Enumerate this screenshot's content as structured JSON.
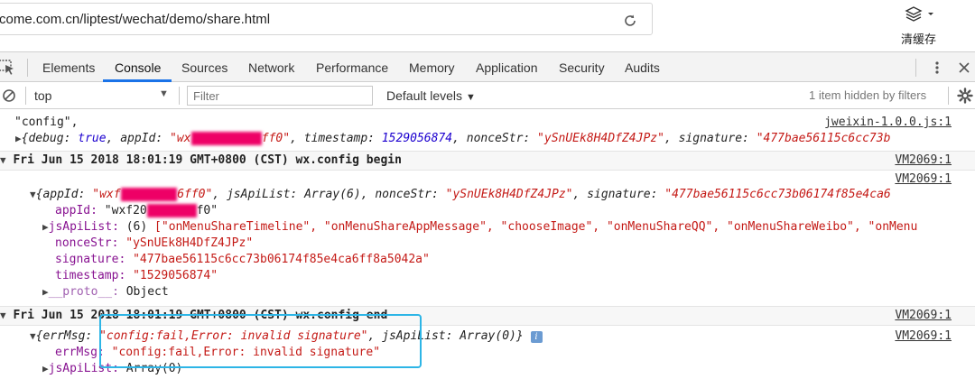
{
  "address_bar": {
    "url": "come.com.cn/liptest/wechat/demo/share.html"
  },
  "toolbar": {
    "clear_cache_label": "清缓存"
  },
  "devtools": {
    "tabs": [
      "Elements",
      "Console",
      "Sources",
      "Network",
      "Performance",
      "Memory",
      "Application",
      "Security",
      "Audits"
    ],
    "active_tab": "Console"
  },
  "console_toolbar": {
    "context": "top",
    "filter_placeholder": "Filter",
    "levels_label": "Default levels",
    "hidden_info": "1 item hidden by filters"
  },
  "console": {
    "l1_text": "\"config\",",
    "l1_src": "jweixin-1.0.0.js:1",
    "l2": {
      "open": "{",
      "k1": "debug:",
      "v1": "true",
      "k2": ", appId:",
      "v2a": "\"wx",
      "v2b": "ff0\"",
      "k3": ", timestamp:",
      "v3": "1529056874",
      "k4": ", nonceStr:",
      "v4": "\"ySnUEk8H4DfZ4JPz\"",
      "k5": ", signature:",
      "v5": "\"477bae56115c6cc73b"
    },
    "l3_text": "Fri Jun 15 2018 18:01:19 GMT+0800 (CST) wx.config begin",
    "l3_src": "VM2069:1",
    "l4_src": "VM2069:1",
    "l5": {
      "open": "{appId:",
      "v1a": "\"wxf",
      "v1b": "6ff0\"",
      "k2": ", jsApiList:",
      "v2": "Array(6)",
      "k3": ", nonceStr:",
      "v3": "\"ySnUEk8H4DfZ4JPz\"",
      "k4": ", signature:",
      "v4": "\"477bae56115c6cc73b06174f85e4ca6"
    },
    "l6": {
      "key": "appId:",
      "va": "\"wxf20",
      "vb": "f0\""
    },
    "l7": {
      "key": "jsApiList:",
      "count": "(6)",
      "items": "[\"onMenuShareTimeline\", \"onMenuShareAppMessage\", \"chooseImage\", \"onMenuShareQQ\", \"onMenuShareWeibo\", \"onMenu"
    },
    "l8": {
      "key": "nonceStr:",
      "val": "\"ySnUEk8H4DfZ4JPz\""
    },
    "l9": {
      "key": "signature:",
      "val": "\"477bae56115c6cc73b06174f85e4ca6ff8a5042a\""
    },
    "l10": {
      "key": "timestamp:",
      "val": "\"1529056874\""
    },
    "l11": {
      "key": "__proto__:",
      "val": "Object"
    },
    "l12_text": "Fri Jun 15 2018 18:01:19 GMT+0800 (CST) wx.config end",
    "l12_src": "VM2069:1",
    "l13": {
      "open": "{errMsg:",
      "v1": "\"config:fail,Error: invalid signature\"",
      "k2": ", jsApiList:",
      "v2": "Array(0)",
      "close": "}",
      "badge": "i"
    },
    "l13_src": "VM2069:1",
    "l14": {
      "key": "errMsg:",
      "val": "\"config:fail,Error: invalid signature\""
    },
    "l15": {
      "key": "jsApiList:",
      "val": "Array(0)"
    }
  },
  "colors": {
    "highlight_box": "#2db5e6",
    "active_tab_underline": "#1a73e8",
    "string": "#c41a16",
    "number": "#1c00cf",
    "key": "#881391"
  }
}
